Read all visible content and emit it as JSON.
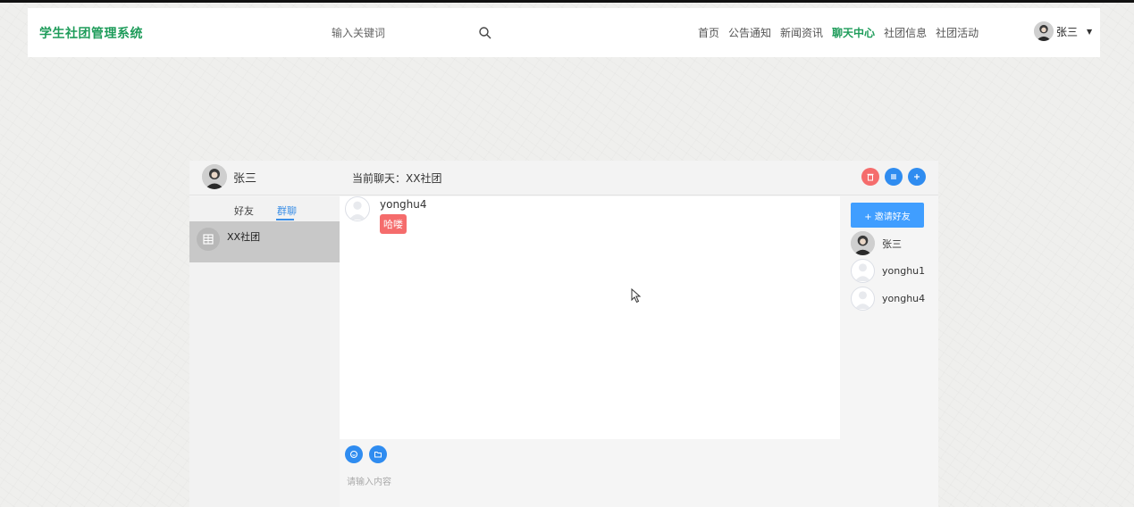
{
  "header": {
    "logo": "学生社团管理系统",
    "search_placeholder": "输入关键词",
    "nav": [
      "首页",
      "公告通知",
      "新闻资讯",
      "聊天中心",
      "社团信息",
      "社团活动"
    ],
    "active_nav": "聊天中心",
    "user_name": "张三"
  },
  "chat": {
    "me_name": "张三",
    "current_label": "当前聊天：XX社团",
    "tabs": [
      "好友",
      "群聊"
    ],
    "active_tab": "群聊",
    "groups": [
      {
        "name": "XX社团"
      }
    ],
    "messages": [
      {
        "sender": "yonghu4",
        "text": "哈喽"
      }
    ],
    "input_placeholder": "请输入内容",
    "invite_label": "+ 邀请好友",
    "members": [
      "张三",
      "yonghu1",
      "yonghu4"
    ]
  },
  "colors": {
    "brand_green": "#1e9c5a",
    "danger": "#f56c6c",
    "primary": "#409eff",
    "icon_blue": "#2f8cf0"
  }
}
